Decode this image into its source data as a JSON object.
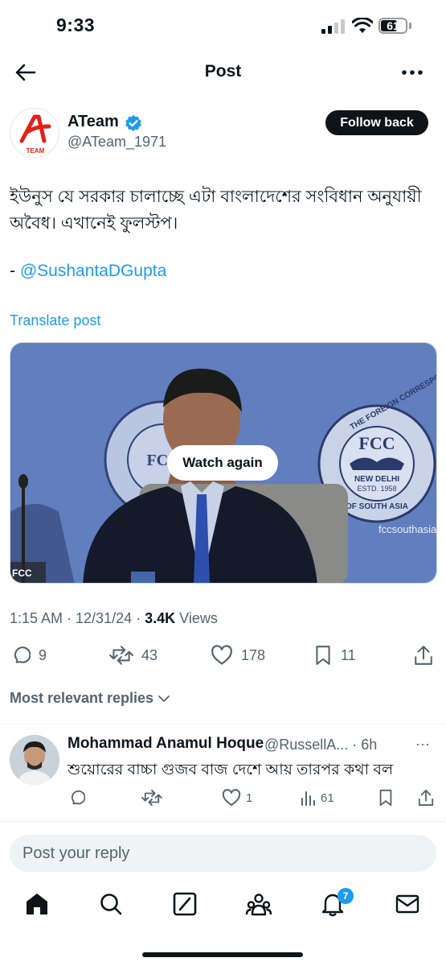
{
  "status_bar": {
    "time": "9:33",
    "battery": "61",
    "battery_level": 0.61
  },
  "header": {
    "title": "Post"
  },
  "author": {
    "name": "ATeam",
    "handle": "@ATeam_1971",
    "avatar_letter": "A",
    "avatar_text": "TEAM",
    "verified": true,
    "follow_label": "Follow back"
  },
  "post": {
    "text": "ইউনুস যে সরকার চালাচ্ছে এটা বাংলাদেশের সংবিধান অনুযায়ী অবৈধ। এখানেই ফুলস্টপ।",
    "attribution_prefix": "- ",
    "mention": "@SushantaDGupta",
    "translate_label": "Translate post",
    "video": {
      "overlay_button": "Watch again",
      "corner_tag": "FCC",
      "emblem_text_top": "THE FOREIGN CORRESPONDENTS' CLUB",
      "emblem_center": "FCC",
      "emblem_city": "NEW DELHI",
      "emblem_year": "ESTD. 1958",
      "emblem_bottom": "OF SOUTH ASIA",
      "website": "fccsouthasia.com"
    },
    "timestamp": "1:15 AM · 12/31/24 · ",
    "views_count": "3.4K",
    "views_label": " Views",
    "actions": {
      "replies": "9",
      "reposts": "43",
      "likes": "178",
      "bookmarks": "11"
    }
  },
  "replies_filter": {
    "label": "Most relevant replies"
  },
  "reply": {
    "name": "Mohammad Anamul Hoque",
    "handle": "@RussellA... · 6h",
    "text": "শুয়োরের বাচ্চা গুজব বাজ দেশে আয় তারপর কথা বল",
    "likes": "1",
    "views": "61"
  },
  "compose": {
    "placeholder": "Post your reply"
  },
  "nav": {
    "notifications_badge": "7"
  },
  "colors": {
    "accent": "#1d9bf0",
    "text": "#0f1419",
    "muted": "#536471"
  }
}
